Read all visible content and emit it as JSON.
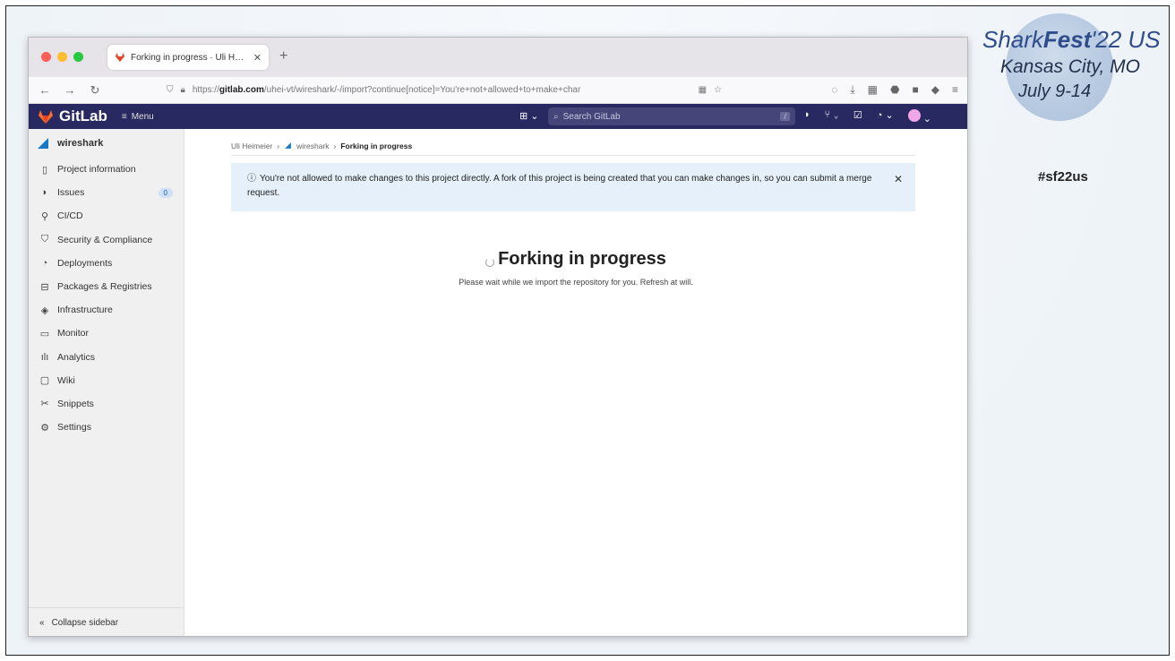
{
  "browser": {
    "tab_title": "Forking in progress · Uli Hellme",
    "url_prefix": "https://",
    "url_domain": "gitlab.com",
    "url_path": "/uhei-vt/wireshark/-/import?continue[notice]=You're+not+allowed+to+make+char"
  },
  "gitlab": {
    "brand": "GitLab",
    "menu_label": "Menu",
    "search_placeholder": "Search GitLab",
    "search_shortcut": "/"
  },
  "sidebar": {
    "project_name": "wireshark",
    "items": [
      {
        "label": "Project information"
      },
      {
        "label": "Issues",
        "badge": "0"
      },
      {
        "label": "CI/CD"
      },
      {
        "label": "Security & Compliance"
      },
      {
        "label": "Deployments"
      },
      {
        "label": "Packages & Registries"
      },
      {
        "label": "Infrastructure"
      },
      {
        "label": "Monitor"
      },
      {
        "label": "Analytics"
      },
      {
        "label": "Wiki"
      },
      {
        "label": "Snippets"
      },
      {
        "label": "Settings"
      }
    ],
    "collapse_label": "Collapse sidebar"
  },
  "breadcrumb": {
    "user": "Uli Heimeier",
    "project": "wireshark",
    "current": "Forking in progress"
  },
  "alert": {
    "message": "You're not allowed to make changes to this project directly. A fork of this project is being created that you can make changes in, so you can submit a merge request."
  },
  "main": {
    "title": "Forking in progress",
    "subtitle": "Please wait while we import the repository for you. Refresh at will."
  },
  "branding": {
    "event_light": "Shark",
    "event_bold": "Fest",
    "event_year": "'22 US",
    "city": "Kansas City, MO",
    "dates": "July 9-14",
    "hashtag": "#sf22us"
  }
}
